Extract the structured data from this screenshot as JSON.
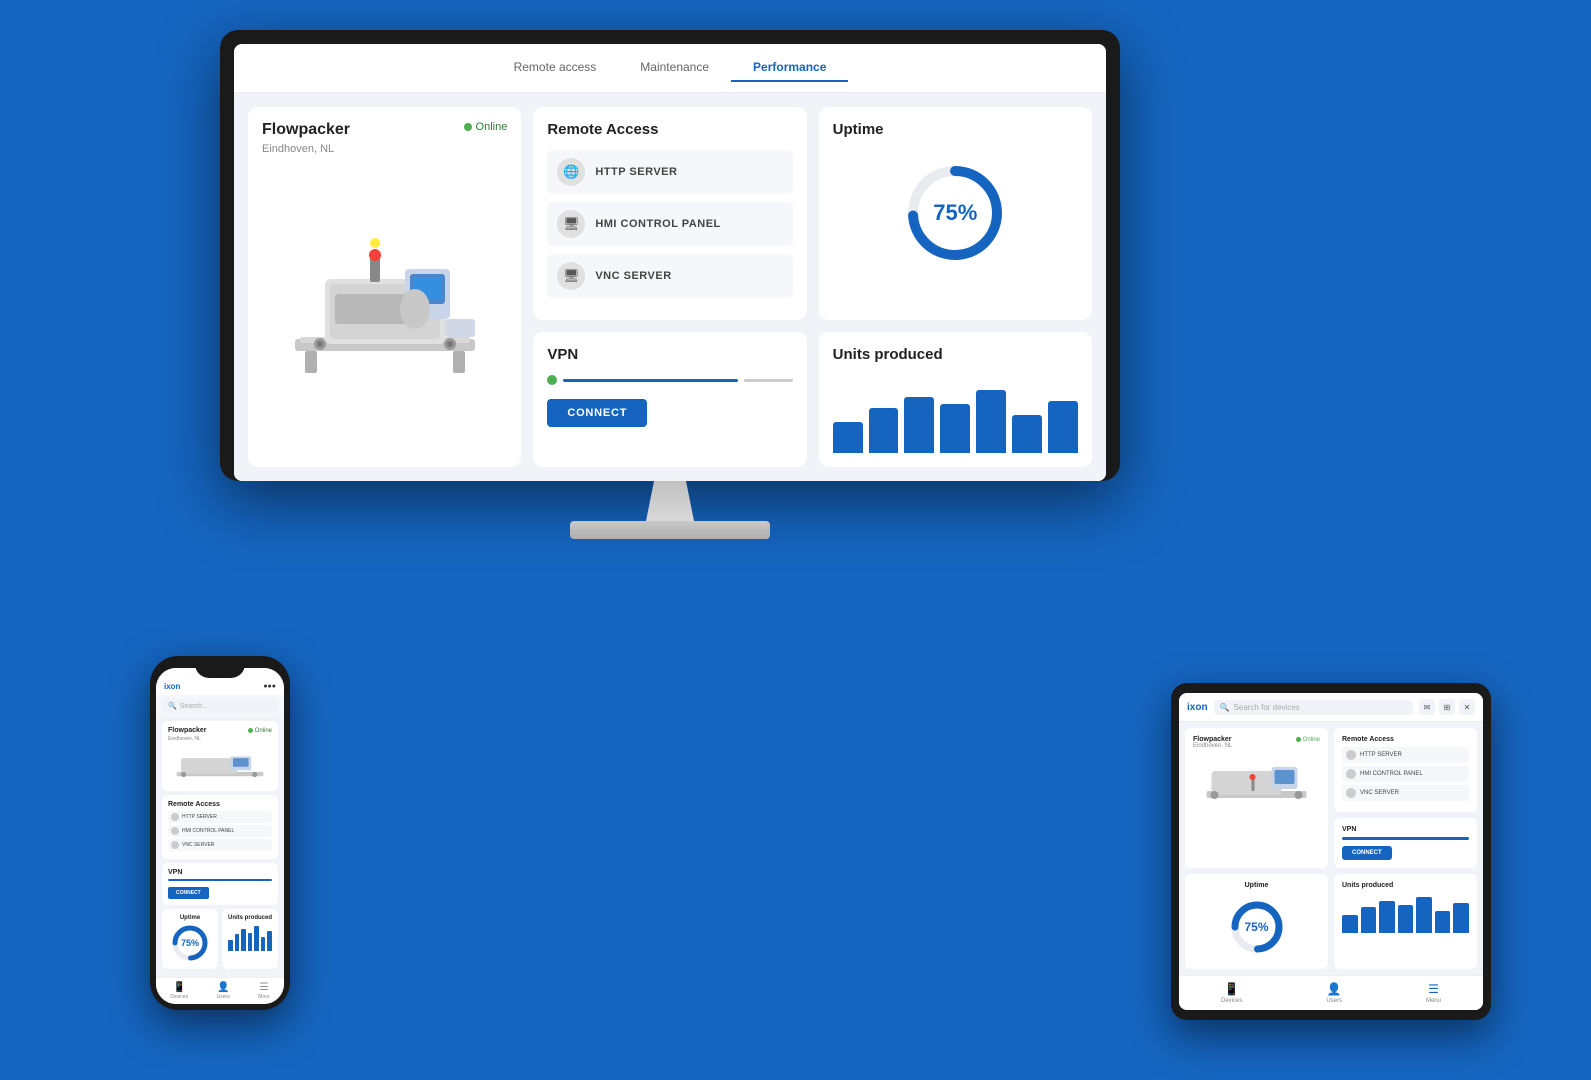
{
  "app": {
    "name": "IXON",
    "logo": "ixon"
  },
  "monitor": {
    "tabs": [
      {
        "label": "Remote access",
        "active": false
      },
      {
        "label": "Maintenance",
        "active": false
      },
      {
        "label": "Performance",
        "active": true
      }
    ],
    "machine_card": {
      "name": "Flowpacker",
      "location": "Eindhoven, NL",
      "status": "Online"
    },
    "remote_access": {
      "title": "Remote Access",
      "items": [
        {
          "label": "HTTP SERVER",
          "icon": "🌐"
        },
        {
          "label": "HMI CONTROL PANEL",
          "icon": "🖥"
        },
        {
          "label": "VNC SERVER",
          "icon": "🖥"
        }
      ]
    },
    "uptime": {
      "title": "Uptime",
      "value": "75%",
      "percent": 75
    },
    "vpn": {
      "title": "VPN",
      "connect_label": "CONNECT"
    },
    "units_produced": {
      "title": "Units produced",
      "bars": [
        45,
        65,
        80,
        70,
        90,
        55,
        75
      ]
    }
  },
  "tablet": {
    "search_placeholder": "Search for devices",
    "machine_name": "Flowpacker",
    "machine_location": "Eindhoven, NL",
    "status": "Online",
    "remote_items": [
      "HTTP SERVER",
      "HMI CONTROL PANEL",
      "VNC SERVER"
    ],
    "uptime_value": "75%",
    "uptime_percent": 75,
    "connect_label": "CONNECT",
    "bars": [
      45,
      65,
      80,
      70,
      90,
      55,
      75
    ],
    "nav_items": [
      {
        "label": "Devices",
        "icon": "📱"
      },
      {
        "label": "Users",
        "icon": "👤"
      },
      {
        "label": "Menu",
        "icon": "☰"
      }
    ]
  },
  "phone": {
    "machine_name": "Flowpacker",
    "machine_location": "Eindhoven, NL",
    "status": "Online",
    "uptime_value": "75%",
    "uptime_percent": 75,
    "bars": [
      40,
      60,
      80,
      65,
      90,
      50,
      70
    ],
    "nav_items": [
      {
        "label": "Devices",
        "icon": "📱"
      },
      {
        "label": "Users",
        "icon": "👤"
      },
      {
        "label": "More",
        "icon": "☰"
      }
    ]
  },
  "colors": {
    "primary": "#1565C0",
    "background": "#1976D2",
    "online_green": "#4caf50",
    "card_bg": "#ffffff",
    "page_bg": "#f0f3f7"
  }
}
